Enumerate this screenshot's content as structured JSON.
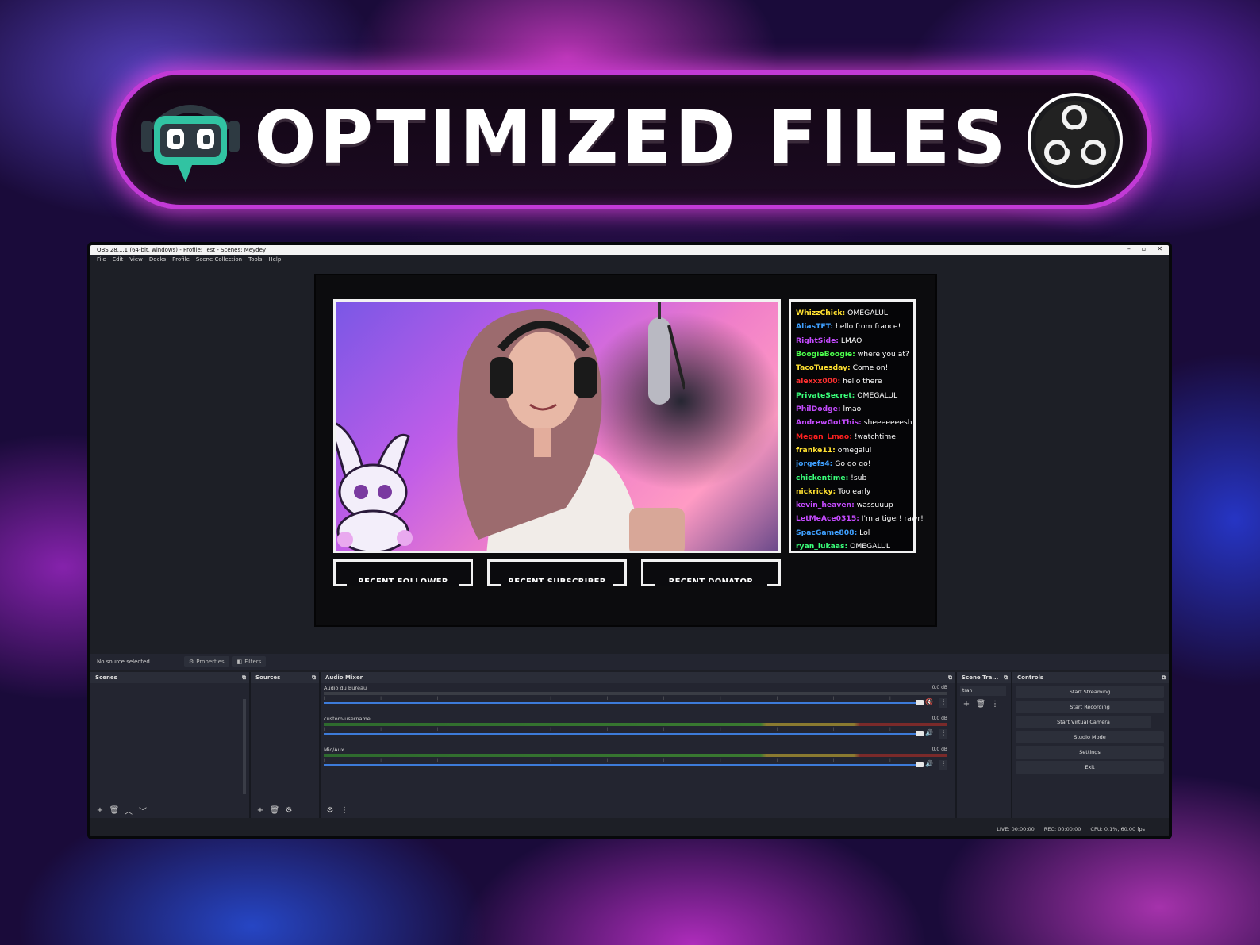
{
  "banner": {
    "title": "OPTIMIZED FILES"
  },
  "obs": {
    "window_title": "OBS 28.1.1 (64-bit, windows) - Profile: Test - Scenes: Meydey",
    "menu": [
      "File",
      "Edit",
      "View",
      "Docks",
      "Profile",
      "Scene Collection",
      "Tools",
      "Help"
    ],
    "chat": [
      {
        "user": "WhizzChick:",
        "msg": " OMEGALUL",
        "color": "#ffe030"
      },
      {
        "user": "AliasTFT:",
        "msg": " hello from france!",
        "color": "#3fa0ff"
      },
      {
        "user": "RightSide:",
        "msg": " LMAO",
        "color": "#c54bff"
      },
      {
        "user": "BoogieBoogie:",
        "msg": " where you at?",
        "color": "#4cff4c"
      },
      {
        "user": "TacoTuesday:",
        "msg": " Come on!",
        "color": "#ffe030"
      },
      {
        "user": "alexxx000:",
        "msg": " hello there",
        "color": "#ff3030"
      },
      {
        "user": "PrivateSecret:",
        "msg": " OMEGALUL",
        "color": "#3aff7a"
      },
      {
        "user": "PhilDodge:",
        "msg": " lmao",
        "color": "#c54bff"
      },
      {
        "user": "AndrewGotThis:",
        "msg": " sheeeeeeesh",
        "color": "#c54bff"
      },
      {
        "user": "Megan_Lmao:",
        "msg": " !watchtime",
        "color": "#ff2020"
      },
      {
        "user": "franke11:",
        "msg": " omegalul",
        "color": "#ffe030"
      },
      {
        "user": "jorgefs4:",
        "msg": " Go go go!",
        "color": "#3fa0ff"
      },
      {
        "user": "chickentime:",
        "msg": " !sub",
        "color": "#3aff7a"
      },
      {
        "user": "nickricky:",
        "msg": " Too early",
        "color": "#ffe030"
      },
      {
        "user": "kevin_heaven:",
        "msg": " wassuuup",
        "color": "#c54bff"
      },
      {
        "user": "LetMeAce0315:",
        "msg": " I'm a tiger! rawr!",
        "color": "#c54bff"
      },
      {
        "user": "SpacGame808:",
        "msg": " Lol",
        "color": "#3fa0ff"
      },
      {
        "user": "ryan_lukaas:",
        "msg": " OMEGALUL",
        "color": "#3aff7a"
      }
    ],
    "recent": {
      "follower": "RECENT FOLLOWER",
      "subscriber": "RECENT SUBSCRIBER",
      "donator": "RECENT DONATOR"
    },
    "source_bar": {
      "status": "No source selected",
      "properties": "Properties",
      "filters": "Filters"
    },
    "docks": {
      "scenes": "Scenes",
      "sources": "Sources",
      "audio_mixer": "Audio Mixer",
      "scene_transitions": "Scene Tra...",
      "controls": "Controls"
    },
    "mixer": [
      {
        "name": "Audio du Bureau",
        "db": "0.0 dB"
      },
      {
        "name": "custom-username",
        "db": "0.0 dB"
      },
      {
        "name": "Mic/Aux",
        "db": "0.0 dB"
      }
    ],
    "transition": {
      "selected": "tran"
    },
    "controls": [
      "Start Streaming",
      "Start Recording",
      "Start Virtual Camera",
      "Studio Mode",
      "Settings",
      "Exit"
    ],
    "status": {
      "live": "LIVE: 00:00:00",
      "rec": "REC: 00:00:00",
      "cpu": "CPU: 0.1%, 60.00 fps"
    }
  }
}
